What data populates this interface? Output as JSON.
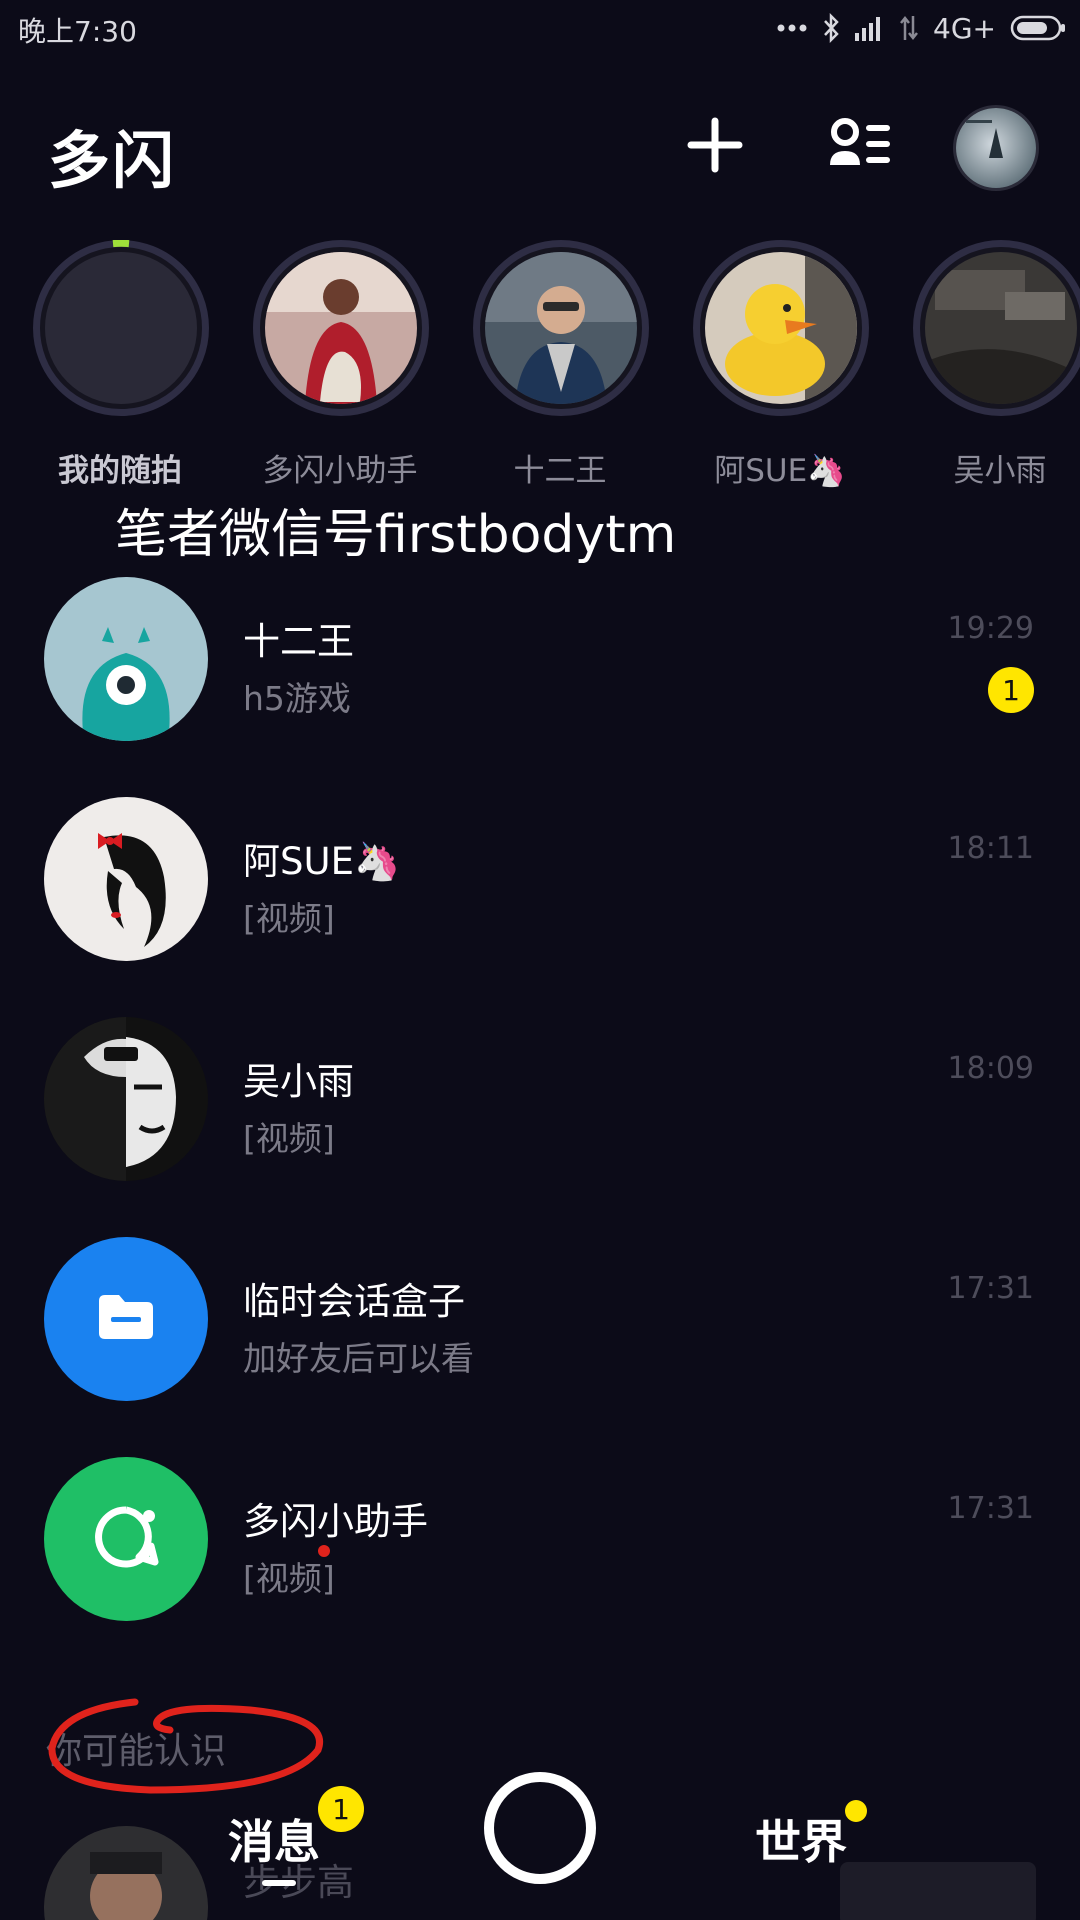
{
  "status_bar": {
    "time": "晚上7:30",
    "network": "4G+"
  },
  "header": {
    "title": "多闪"
  },
  "stories": [
    {
      "label": "我的随拍"
    },
    {
      "label": "多闪小助手"
    },
    {
      "label": "十二王"
    },
    {
      "label": "阿SUE🦄"
    },
    {
      "label": "吴小雨"
    }
  ],
  "watermark": "笔者微信号firstbodytm",
  "conversations": [
    {
      "name": "十二王",
      "preview": "h5游戏",
      "time": "19:29",
      "unread": "1"
    },
    {
      "name": "阿SUE🦄",
      "preview": "[视频]",
      "time": "18:11"
    },
    {
      "name": "吴小雨",
      "preview": "[视频]",
      "time": "18:09"
    },
    {
      "name": "临时会话盒子",
      "preview": "加好友后可以看",
      "time": "17:31"
    },
    {
      "name": "多闪小助手",
      "preview": "[视频]",
      "time": "17:31"
    }
  ],
  "suggestions": {
    "label": "你可能认识",
    "first_name": "步步高"
  },
  "bottom_nav": {
    "messages_label": "消息",
    "messages_badge": "1",
    "world_label": "世界"
  },
  "colors": {
    "background": "#0c0b18",
    "badge": "#ffe600",
    "folder_avatar": "#1a82f0",
    "assistant_avatar": "#1fbf66",
    "annotation": "#e0231c"
  }
}
